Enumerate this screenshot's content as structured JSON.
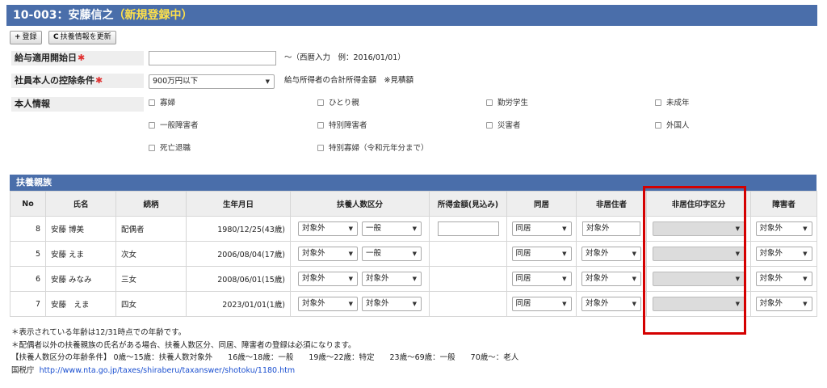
{
  "header": {
    "title": "10-003：安藤信之",
    "status": "（新規登録中）"
  },
  "toolbar": {
    "register_icon": "+",
    "register_label": "登録",
    "refresh_icon": "C",
    "refresh_label": "扶養情報を更新"
  },
  "form": {
    "start_date": {
      "label": "給与適用開始日",
      "required_mark": "✱",
      "value": "",
      "note": "〜（西暦入力　例：2016/01/01）"
    },
    "deduction": {
      "label": "社員本人の控除条件",
      "required_mark": "✱",
      "selected": "900万円以下",
      "note": "給与所得者の合計所得金額　※見積額"
    },
    "personal": {
      "label": "本人情報",
      "checkboxes": [
        "寡婦",
        "ひとり親",
        "勤労学生",
        "未成年",
        "一般障害者",
        "特別障害者",
        "災害者",
        "外国人",
        "死亡退職",
        "特別寡婦（令和元年分まで）"
      ]
    }
  },
  "dependents": {
    "section_title": "扶養親族",
    "columns": [
      "No",
      "氏名",
      "続柄",
      "生年月日",
      "扶養人数区分",
      "所得金額(見込み)",
      "同居",
      "非居住者",
      "非居住印字区分",
      "障害者"
    ],
    "rows": [
      {
        "no": "8",
        "name": "安藤 博美",
        "relation": "配偶者",
        "birth": "1980/12/25(43歳)",
        "count_a": "対象外",
        "count_b": "一般",
        "income": "",
        "cohabit": "同居",
        "nonresident": "対象外",
        "nonresident_print": "",
        "disability": "対象外"
      },
      {
        "no": "5",
        "name": "安藤 えま",
        "relation": "次女",
        "birth": "2006/08/04(17歳)",
        "count_a": "対象外",
        "count_b": "一般",
        "income": "",
        "cohabit": "同居",
        "nonresident": "対象外",
        "nonresident_print": "",
        "disability": "対象外"
      },
      {
        "no": "6",
        "name": "安藤 みなみ",
        "relation": "三女",
        "birth": "2008/06/01(15歳)",
        "count_a": "対象外",
        "count_b": "対象外",
        "income": "",
        "cohabit": "同居",
        "nonresident": "対象外",
        "nonresident_print": "",
        "disability": "対象外"
      },
      {
        "no": "7",
        "name": "安藤　えま",
        "relation": "四女",
        "birth": "2023/01/01(1歳)",
        "count_a": "対象外",
        "count_b": "対象外",
        "income": "",
        "cohabit": "同居",
        "nonresident": "対象外",
        "nonresident_print": "",
        "disability": "対象外"
      }
    ]
  },
  "footnotes": {
    "line1": "＊表示されている年齢は12/31時点での年齢です。",
    "line2": "＊配偶者以外の扶養親族の氏名がある場合、扶養人数区分、同居、障害者の登録は必須になります。",
    "line3": "【扶養人数区分の年齢条件】 0歳〜15歳：扶養人数対象外　　16歳〜18歳：一般　　19歳〜22歳：特定　　23歳〜69歳：一般　　70歳〜：老人",
    "source_label": "国税庁",
    "url": "http://www.nta.go.jp/taxes/shiraberu/taxanswer/shotoku/1180.htm"
  },
  "colors": {
    "header_bg": "#4a6eaa",
    "status_text": "#ffe14a",
    "required": "#e03030",
    "highlight": "#d40000",
    "link": "#1a4fd0"
  }
}
